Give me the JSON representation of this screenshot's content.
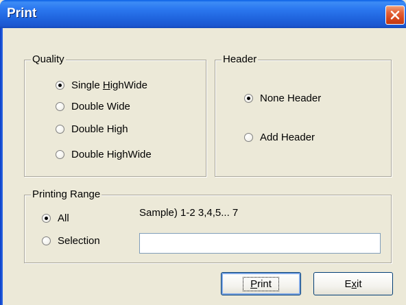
{
  "window": {
    "title": "Print"
  },
  "quality": {
    "label": "Quality",
    "options": [
      {
        "pre": "Single ",
        "mn": "H",
        "post": "ighWide",
        "checked": true
      },
      {
        "pre": "Double Wide",
        "mn": "",
        "post": "",
        "checked": false
      },
      {
        "pre": "Double High",
        "mn": "",
        "post": "",
        "checked": false
      },
      {
        "pre": "Double HighWide",
        "mn": "",
        "post": "",
        "checked": false
      }
    ]
  },
  "header": {
    "label": "Header",
    "options": [
      {
        "text": "None Header",
        "checked": true
      },
      {
        "text": "Add Header",
        "checked": false
      }
    ]
  },
  "range": {
    "label": "Printing Range",
    "all_label": "All",
    "all_checked": true,
    "selection_label": "Selection",
    "selection_checked": false,
    "sample": "Sample) 1-2   3,4,5...  7",
    "selection_value": ""
  },
  "buttons": {
    "print_mn": "P",
    "print_rest": "rint",
    "exit_pre": "E",
    "exit_mn": "x",
    "exit_post": "it"
  },
  "colors": {
    "titlebar": "#2C79F0",
    "close": "#D5471D",
    "dialog_bg": "#ECE9D8"
  }
}
